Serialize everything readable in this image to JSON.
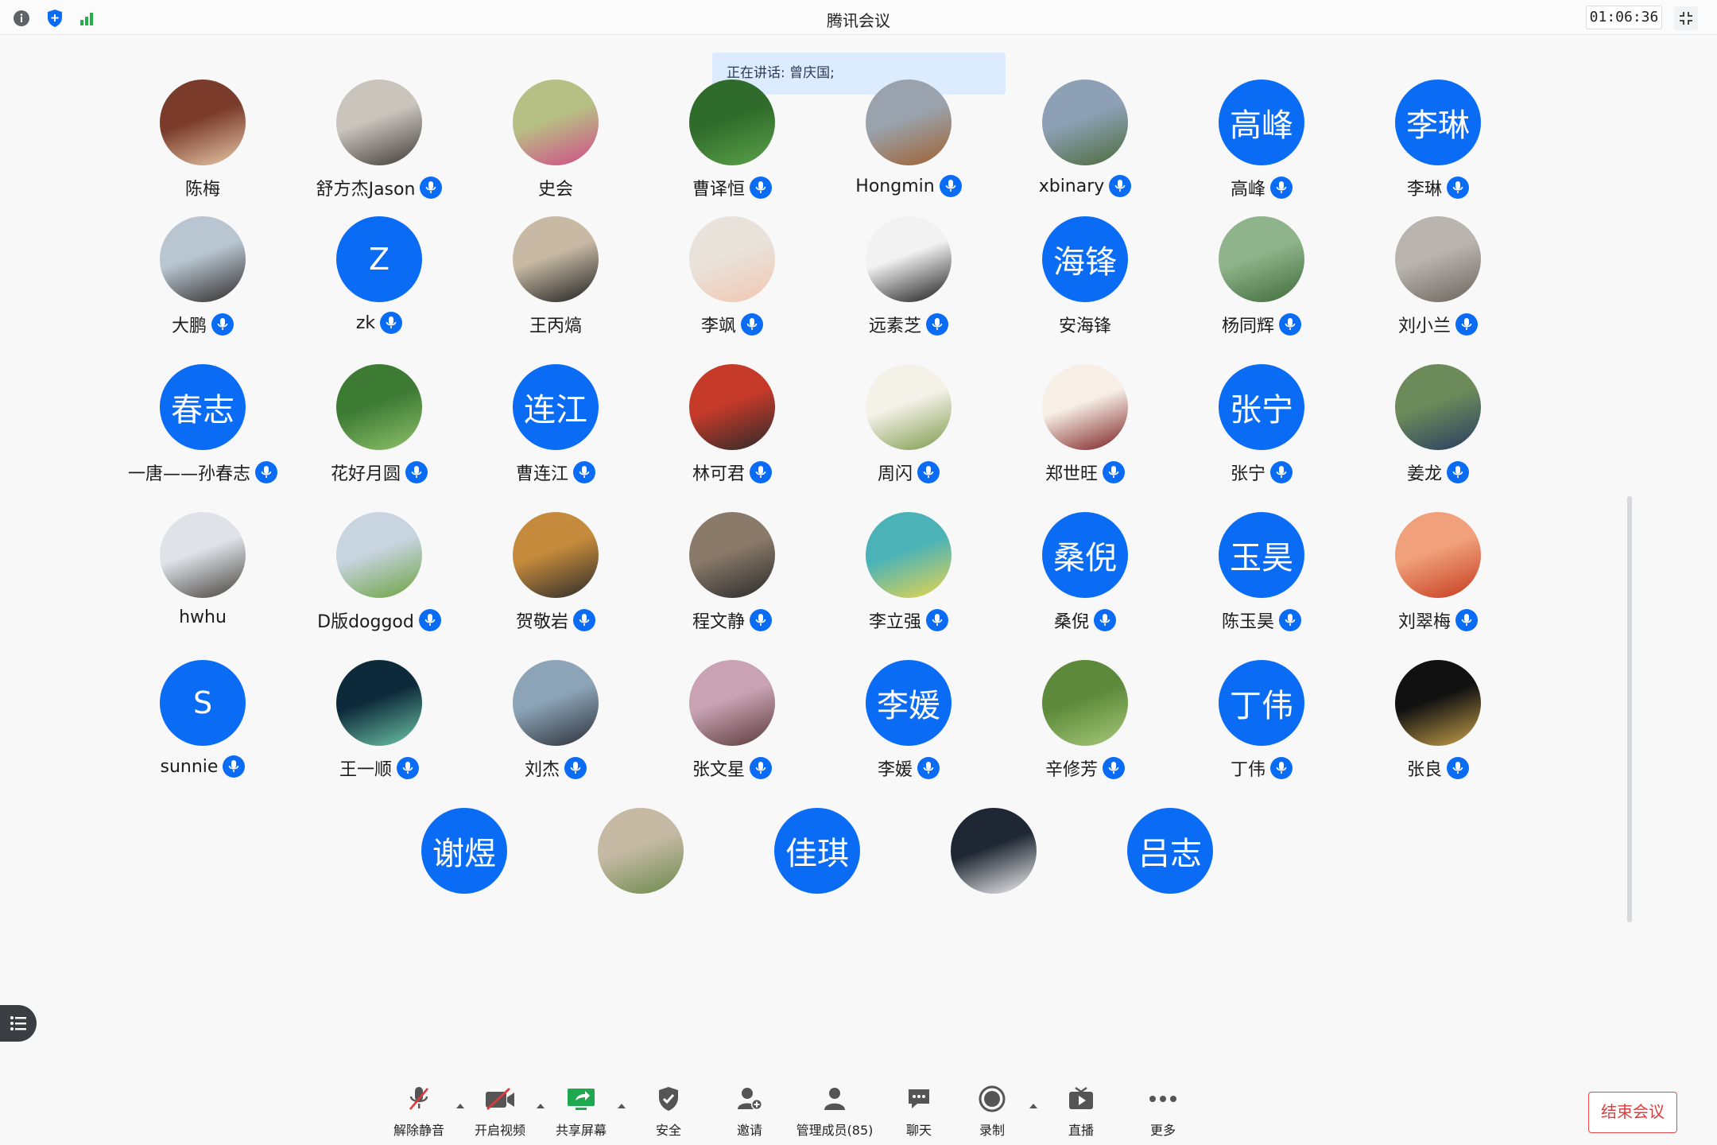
{
  "app": {
    "title": "腾讯会议",
    "timer": "01:06:36"
  },
  "speaking": {
    "text": "正在讲话: 曾庆国;"
  },
  "rows": [
    [
      {
        "name": "陈梅",
        "avatar": "photo",
        "mic": false,
        "colors": [
          "#7a3b2a",
          "#e8c9a8"
        ]
      },
      {
        "name": "舒方杰Jason",
        "avatar": "photo",
        "mic": true,
        "colors": [
          "#c9c4bc",
          "#3f3a35"
        ]
      },
      {
        "name": "史会",
        "avatar": "photo",
        "mic": false,
        "colors": [
          "#b7c084",
          "#d14a8a"
        ]
      },
      {
        "name": "曹译恒",
        "avatar": "photo",
        "mic": true,
        "colors": [
          "#2f6b2a",
          "#5aa24a"
        ]
      },
      {
        "name": "Hongmin",
        "avatar": "photo",
        "mic": true,
        "colors": [
          "#9aa3ad",
          "#a0602f"
        ]
      },
      {
        "name": "xbinary",
        "avatar": "photo",
        "mic": true,
        "colors": [
          "#8da0b5",
          "#4c6b3a"
        ]
      },
      {
        "name": "高峰",
        "avatar": "text",
        "text": "高峰",
        "mic": true
      },
      {
        "name": "李琳",
        "avatar": "text",
        "text": "李琳",
        "mic": true
      }
    ],
    [
      {
        "name": "大鹏",
        "avatar": "photo",
        "mic": true,
        "colors": [
          "#b9c6d2",
          "#2d2a28"
        ]
      },
      {
        "name": "zk",
        "avatar": "text",
        "text": "Z",
        "mic": true
      },
      {
        "name": "王丙熇",
        "avatar": "photo",
        "mic": false,
        "colors": [
          "#c7b9a4",
          "#1f1f1f"
        ]
      },
      {
        "name": "李飒",
        "avatar": "photo",
        "mic": true,
        "colors": [
          "#e9e2da",
          "#f2c7b2"
        ]
      },
      {
        "name": "远素芝",
        "avatar": "photo",
        "mic": true,
        "colors": [
          "#f2f2f2",
          "#1a1a1a"
        ]
      },
      {
        "name": "安海锋",
        "avatar": "text",
        "text": "海锋",
        "mic": false
      },
      {
        "name": "杨同辉",
        "avatar": "photo",
        "mic": true,
        "colors": [
          "#8fb38a",
          "#3f6b3a"
        ]
      },
      {
        "name": "刘小兰",
        "avatar": "photo",
        "mic": true,
        "colors": [
          "#b9b5ae",
          "#6a645c"
        ]
      }
    ],
    [
      {
        "name": "一唐——孙春志",
        "avatar": "text",
        "text": "春志",
        "mic": true
      },
      {
        "name": "花好月圆",
        "avatar": "photo",
        "mic": true,
        "colors": [
          "#3d7a34",
          "#8ec26a"
        ]
      },
      {
        "name": "曹连江",
        "avatar": "text",
        "text": "连江",
        "mic": true
      },
      {
        "name": "林可君",
        "avatar": "photo",
        "mic": true,
        "colors": [
          "#c63a2a",
          "#2a2a2a"
        ]
      },
      {
        "name": "周闪",
        "avatar": "photo",
        "mic": true,
        "colors": [
          "#f4f1e8",
          "#7d9a4a"
        ]
      },
      {
        "name": "郑世旺",
        "avatar": "photo",
        "mic": true,
        "colors": [
          "#f7efe6",
          "#7a1e1e"
        ]
      },
      {
        "name": "张宁",
        "avatar": "text",
        "text": "张宁",
        "mic": true
      },
      {
        "name": "姜龙",
        "avatar": "photo",
        "mic": true,
        "colors": [
          "#6c8a5a",
          "#283c62"
        ]
      }
    ],
    [
      {
        "name": "hwhu",
        "avatar": "photo",
        "mic": false,
        "colors": [
          "#dfe3e8",
          "#45413c"
        ]
      },
      {
        "name": "D版doggod",
        "avatar": "photo",
        "mic": true,
        "colors": [
          "#c8d4e0",
          "#6aa23e"
        ]
      },
      {
        "name": "贺敬岩",
        "avatar": "photo",
        "mic": true,
        "colors": [
          "#c58a3b",
          "#2b2b2b"
        ]
      },
      {
        "name": "程文静",
        "avatar": "photo",
        "mic": true,
        "colors": [
          "#8a7a6a",
          "#2a2a2a"
        ]
      },
      {
        "name": "李立强",
        "avatar": "photo",
        "mic": true,
        "colors": [
          "#4bb3b8",
          "#e9d54a"
        ]
      },
      {
        "name": "桑倪",
        "avatar": "text",
        "text": "桑倪",
        "mic": true
      },
      {
        "name": "陈玉昊",
        "avatar": "text",
        "text": "玉昊",
        "mic": true
      },
      {
        "name": "刘翠梅",
        "avatar": "photo",
        "mic": true,
        "colors": [
          "#f0a07a",
          "#c53a1e"
        ]
      }
    ],
    [
      {
        "name": "sunnie",
        "avatar": "text",
        "text": "S",
        "mic": true
      },
      {
        "name": "王一顺",
        "avatar": "photo",
        "mic": true,
        "colors": [
          "#0d2a3a",
          "#6fc7a8"
        ]
      },
      {
        "name": "刘杰",
        "avatar": "photo",
        "mic": true,
        "colors": [
          "#8da4b8",
          "#2a3038"
        ]
      },
      {
        "name": "张文星",
        "avatar": "photo",
        "mic": true,
        "colors": [
          "#c9a3b4",
          "#5a3a3a"
        ]
      },
      {
        "name": "李媛",
        "avatar": "text",
        "text": "李媛",
        "mic": true
      },
      {
        "name": "辛修芳",
        "avatar": "photo",
        "mic": true,
        "colors": [
          "#5c8a3a",
          "#a6c878"
        ]
      },
      {
        "name": "丁伟",
        "avatar": "text",
        "text": "丁伟",
        "mic": true
      },
      {
        "name": "张良",
        "avatar": "photo",
        "mic": true,
        "colors": [
          "#111111",
          "#c9a24a"
        ]
      }
    ],
    [
      {
        "name": "",
        "avatar": "text",
        "text": "谢煜",
        "mic": false
      },
      {
        "name": "",
        "avatar": "photo",
        "mic": false,
        "colors": [
          "#c5b9a4",
          "#6b8a4a"
        ]
      },
      {
        "name": "",
        "avatar": "text",
        "text": "佳琪",
        "mic": false
      },
      {
        "name": "",
        "avatar": "photo",
        "mic": false,
        "colors": [
          "#1e2733",
          "#f2f2f2"
        ]
      },
      {
        "name": "",
        "avatar": "text",
        "text": "吕志",
        "mic": false
      }
    ]
  ],
  "toolbar": {
    "unmute": "解除静音",
    "video": "开启视频",
    "share": "共享屏幕",
    "security": "安全",
    "invite": "邀请",
    "members": "管理成员(85)",
    "chat": "聊天",
    "record": "录制",
    "live": "直播",
    "more": "更多",
    "end": "结束会议"
  },
  "colors": {
    "accent": "#0a6cf5",
    "danger": "#e03a3c"
  }
}
